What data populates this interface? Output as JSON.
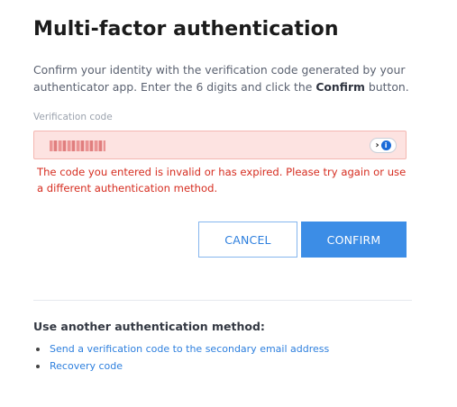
{
  "page": {
    "title": "Multi-factor authentication",
    "description_pre": "Confirm your identity with the verification code generated by your authenticator app. Enter the 6 digits and click the ",
    "description_bold": "Confirm",
    "description_post": " button."
  },
  "verification": {
    "label": "Verification code",
    "value_masked": true,
    "error": "The code you entered is invalid or has expired. Please try again or use a different authentication method.",
    "password_manager_icon": "password-manager-icon"
  },
  "actions": {
    "cancel_label": "CANCEL",
    "confirm_label": "CONFIRM"
  },
  "alternatives": {
    "heading": "Use another authentication method:",
    "options": [
      {
        "label": "Send a verification code to the secondary email address"
      },
      {
        "label": "Recovery code"
      }
    ]
  },
  "colors": {
    "accent": "#3c8de6",
    "error": "#d62d20",
    "error_field_bg": "#fde3e1",
    "error_field_border": "#f4b7b1"
  }
}
